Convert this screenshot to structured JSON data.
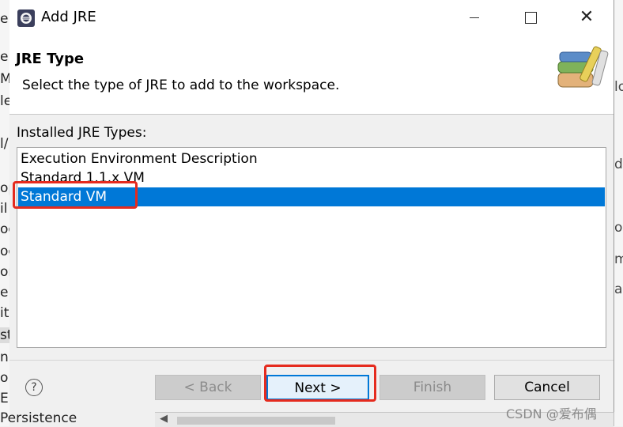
{
  "background": {
    "left_fragments": [
      "er",
      "er",
      "M",
      "le",
      "l/",
      "op",
      "il",
      "oo",
      "oc",
      "on",
      "eb",
      "it",
      "st",
      "n",
      "o",
      "E"
    ],
    "right_fragments": [
      "lo",
      "d",
      "oli",
      "m",
      "a"
    ],
    "bottom_text": "Persistence"
  },
  "window": {
    "title": "Add JRE",
    "minimize": "Minimize",
    "maximize": "Maximize",
    "close": "✕"
  },
  "header": {
    "title": "JRE Type",
    "description": "Select the type of JRE to add to the workspace."
  },
  "installed_label": "Installed JRE Types:",
  "jre_types": [
    {
      "label": "Execution Environment Description",
      "selected": false
    },
    {
      "label": "Standard 1.1.x VM",
      "selected": false
    },
    {
      "label": "Standard VM",
      "selected": true
    }
  ],
  "buttons": {
    "help": "?",
    "back": "< Back",
    "next": "Next >",
    "finish": "Finish",
    "cancel": "Cancel"
  },
  "colors": {
    "selection": "#0078d7",
    "annotation": "#e52b1e"
  },
  "watermark": "CSDN @爱布偶"
}
